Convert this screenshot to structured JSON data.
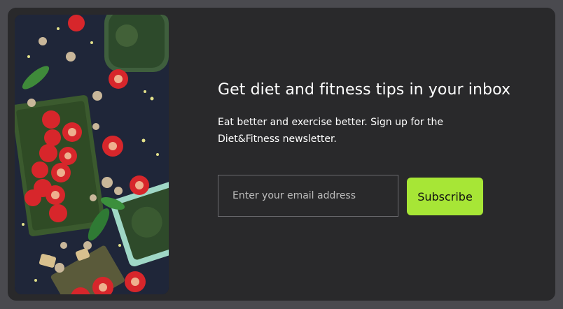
{
  "signup": {
    "headline": "Get diet and fitness tips in your inbox",
    "description": "Eat better and exercise better. Sign up for the Diet&Fitness newsletter.",
    "email_placeholder": "Enter your email address",
    "email_value": "",
    "subscribe_label": "Subscribe"
  },
  "colors": {
    "page_bg": "#4a4a4f",
    "card_bg": "#29292b",
    "accent": "#a7e636",
    "text": "#ffffff"
  }
}
